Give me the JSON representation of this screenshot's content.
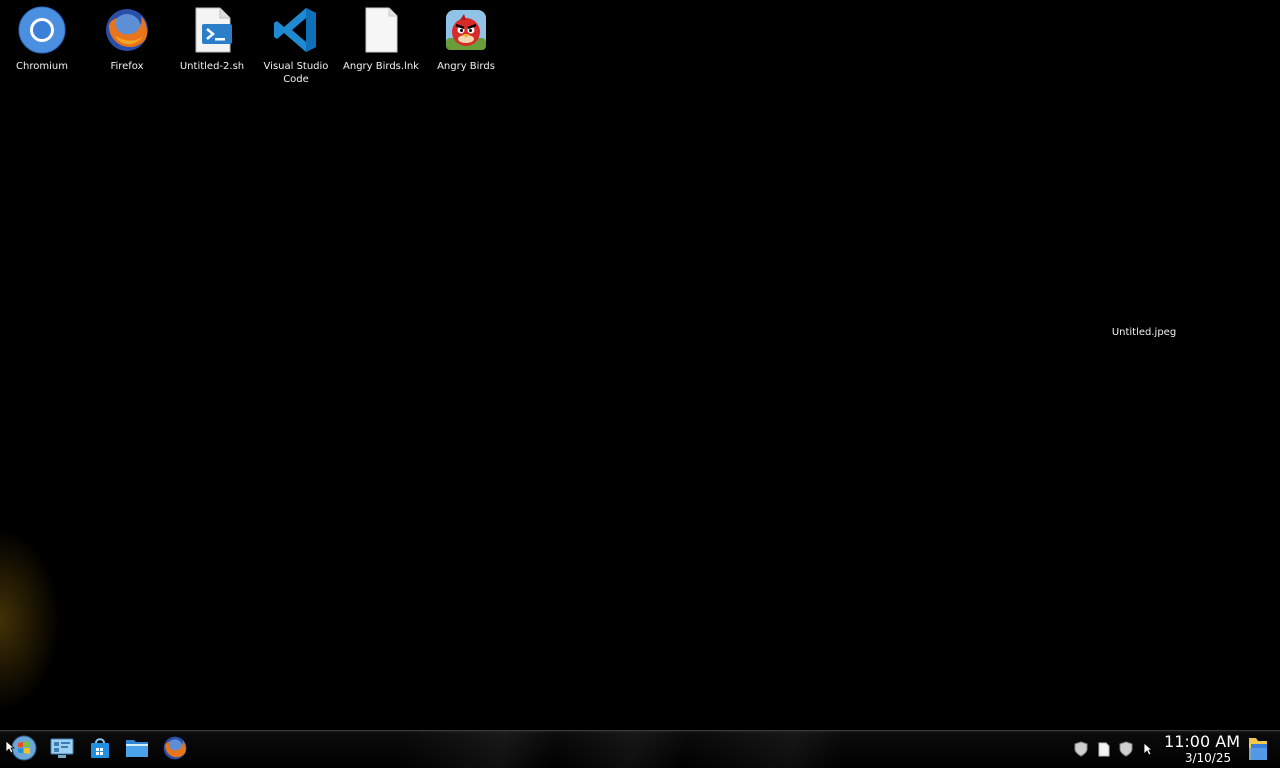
{
  "desktop": {
    "icons": [
      {
        "label": "Chromium",
        "icon": "chromium-icon"
      },
      {
        "label": "Firefox",
        "icon": "firefox-icon"
      },
      {
        "label": "Untitled-2.sh",
        "icon": "script-file-icon"
      },
      {
        "label": "Visual Studio Code",
        "icon": "vscode-icon"
      },
      {
        "label": "Angry Birds.lnk",
        "icon": "blank-file-icon"
      },
      {
        "label": "Angry Birds",
        "icon": "angry-birds-icon"
      }
    ],
    "loose_file_label": "Untitled.jpeg"
  },
  "taskbar": {
    "pinned": [
      {
        "name": "start-button",
        "icon": "start-orb-icon"
      },
      {
        "name": "control-panel-button",
        "icon": "control-panel-icon"
      },
      {
        "name": "store-button",
        "icon": "store-bag-icon"
      },
      {
        "name": "file-explorer-button",
        "icon": "folder-icon"
      },
      {
        "name": "firefox-button",
        "icon": "firefox-icon"
      }
    ],
    "tray": [
      {
        "icon": "shield-icon"
      },
      {
        "icon": "document-icon"
      },
      {
        "icon": "shield-icon"
      },
      {
        "icon": "cursor-icon"
      }
    ],
    "clock": {
      "time": "11:00 AM",
      "date": "3/10/25"
    }
  },
  "colors": {
    "background": "#000000",
    "taskbar": "#0b0b0b",
    "label_text": "#f2f2f2"
  }
}
